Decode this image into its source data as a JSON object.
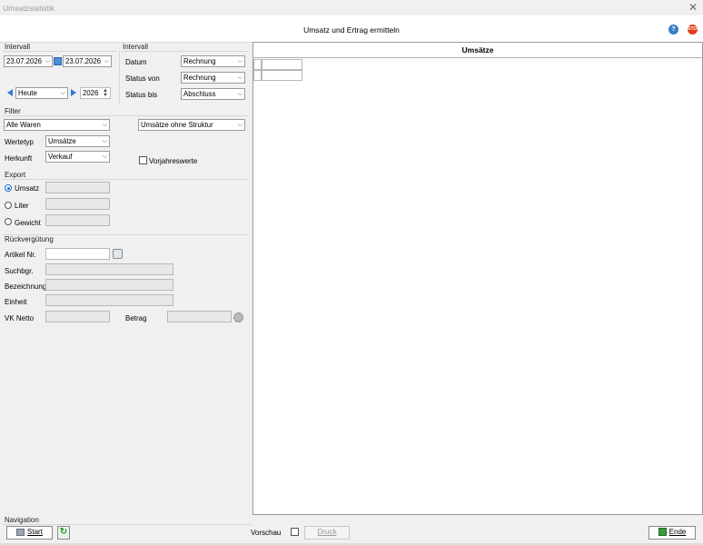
{
  "window": {
    "title": "Umsatzstatistik",
    "close": "✕"
  },
  "header": {
    "title": "Umsatz und Ertrag ermitteln",
    "help_icon": "?",
    "stop_icon": "STOP"
  },
  "intervall_left": {
    "section_label": "Intervall",
    "date_from": "23.07.2026",
    "date_to": "23.07.2026",
    "period": "Heute",
    "year": "2026"
  },
  "intervall_right": {
    "section_label": "Intervall",
    "rows": [
      {
        "label": "Datum",
        "value": "Rechnung"
      },
      {
        "label": "Status von",
        "value": "Rechnung"
      },
      {
        "label": "Status bis",
        "value": "Abschluss"
      }
    ]
  },
  "filter": {
    "section_label": "Filter",
    "goods": "Alle Waren",
    "structure": "Umsätze ohne Struktur",
    "wertetyp_label": "Wertetyp",
    "wertetyp": "Umsätze",
    "herkunft_label": "Herkunft",
    "herkunft": "Verkauf",
    "vorjahres_label": "Vorjahreswerte"
  },
  "export": {
    "section_label": "Export",
    "options": [
      {
        "label": "Umsatz",
        "selected": true
      },
      {
        "label": "Liter",
        "selected": false
      },
      {
        "label": "Gewicht",
        "selected": false
      }
    ]
  },
  "rueck": {
    "section_label": "Rückvergütung",
    "artikel_label": "Artikel Nr.",
    "suchbgr_label": "Suchbgr.",
    "bezeichnung_label": "Bezeichnung",
    "einheit_label": "Einheit",
    "vk_label": "VK Netto",
    "betrag_label": "Betrag"
  },
  "table": {
    "title": "Umsätze"
  },
  "navigation": {
    "section_label": "Navigation",
    "start_label": "Start",
    "vorschau_label": "Vorschau",
    "druck_label": "Druck",
    "ende_label": "Ende"
  }
}
